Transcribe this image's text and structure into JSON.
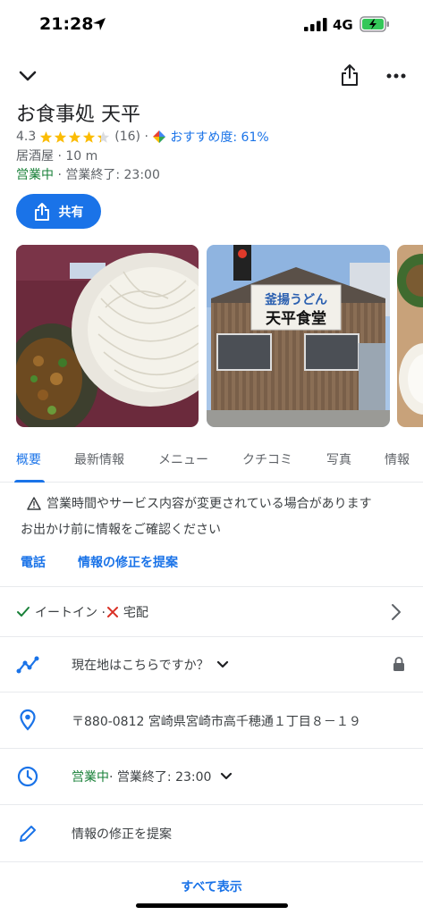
{
  "status_bar": {
    "time": "21:28",
    "network": "4G"
  },
  "place": {
    "title": "お食事処 天平",
    "rating": "4.3",
    "review_count": "(16)",
    "stars": 4.3,
    "recommend": "おすすめ度: 61%",
    "category": "居酒屋 · 10 m",
    "open_status": "営業中",
    "close_time": " · 営業終了: 23:00"
  },
  "share_label": "共有",
  "photos": {
    "sign_line1": "釜揚うどん",
    "sign_line2": "天平食堂"
  },
  "tabs": [
    "概要",
    "最新情報",
    "メニュー",
    "クチコミ",
    "写真",
    "情報"
  ],
  "warning": {
    "line1": "営業時間やサービス内容が変更されている場合があります",
    "line2": "お出かけ前に情報をご確認ください",
    "call": "電話",
    "suggest": "情報の修正を提案"
  },
  "services": {
    "eat_in": "イートイン · ",
    "delivery": "宅配"
  },
  "location_prompt": "現在地はこちらですか？",
  "address": "〒880-0812 宮崎県宮崎市高千穂通１丁目８－１９",
  "hours": {
    "status": "営業中",
    "close": " · 営業終了: 23:00"
  },
  "suggest_edit": "情報の修正を提案",
  "show_all": "すべて表示",
  "colors": {
    "accent": "#1a73e8",
    "open": "#188038",
    "star": "#fbbc04"
  }
}
